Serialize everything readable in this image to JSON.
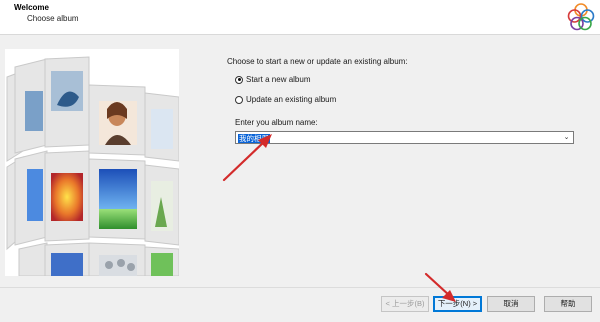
{
  "header": {
    "title": "Welcome",
    "subtitle": "Choose album",
    "logo_colors": [
      "#f28c28",
      "#d63b3b",
      "#7a3fa0",
      "#2a7ac8",
      "#3aa64a"
    ]
  },
  "form": {
    "prompt": "Choose to start a new or update an existing album:",
    "options": [
      {
        "label": "Start a new album",
        "checked": true
      },
      {
        "label": "Update an existing album",
        "checked": false
      }
    ],
    "name_label": "Enter you album name:",
    "album_name": "我的相册"
  },
  "footer": {
    "back": "< 上一步(B)",
    "next": "下一步(N) >",
    "cancel": "取消",
    "help": "帮助"
  },
  "colors": {
    "selection": "#0a64d8",
    "annotation_arrow": "#d32b2b"
  },
  "icons": {
    "dropdown": "chevron-down-icon",
    "logo": "rings-logo-icon"
  }
}
